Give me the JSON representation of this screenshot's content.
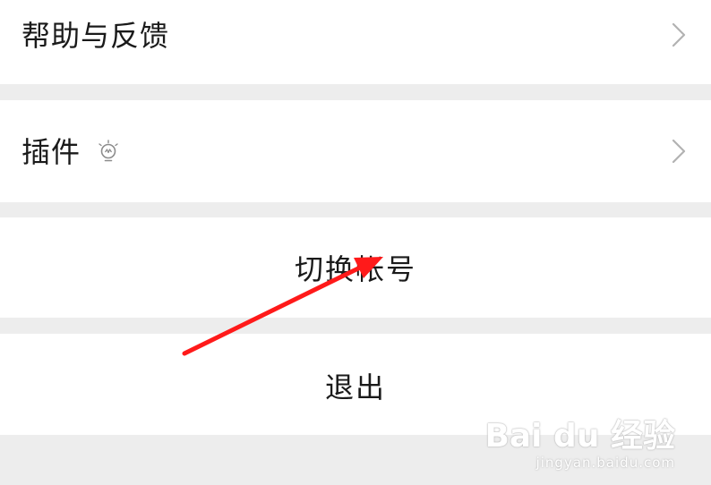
{
  "menu": {
    "help_feedback_label": "帮助与反馈",
    "plugins_label": "插件",
    "plugins_icon": "lightbulb-icon",
    "chevron_icon": "chevron-right-icon",
    "switch_account_label": "切换帐号",
    "logout_label": "退出"
  },
  "annotation": {
    "arrow_color": "#ff1a1a"
  },
  "watermark": {
    "brand": "Bai du 经验",
    "site": "jingyan.baidu.com"
  }
}
